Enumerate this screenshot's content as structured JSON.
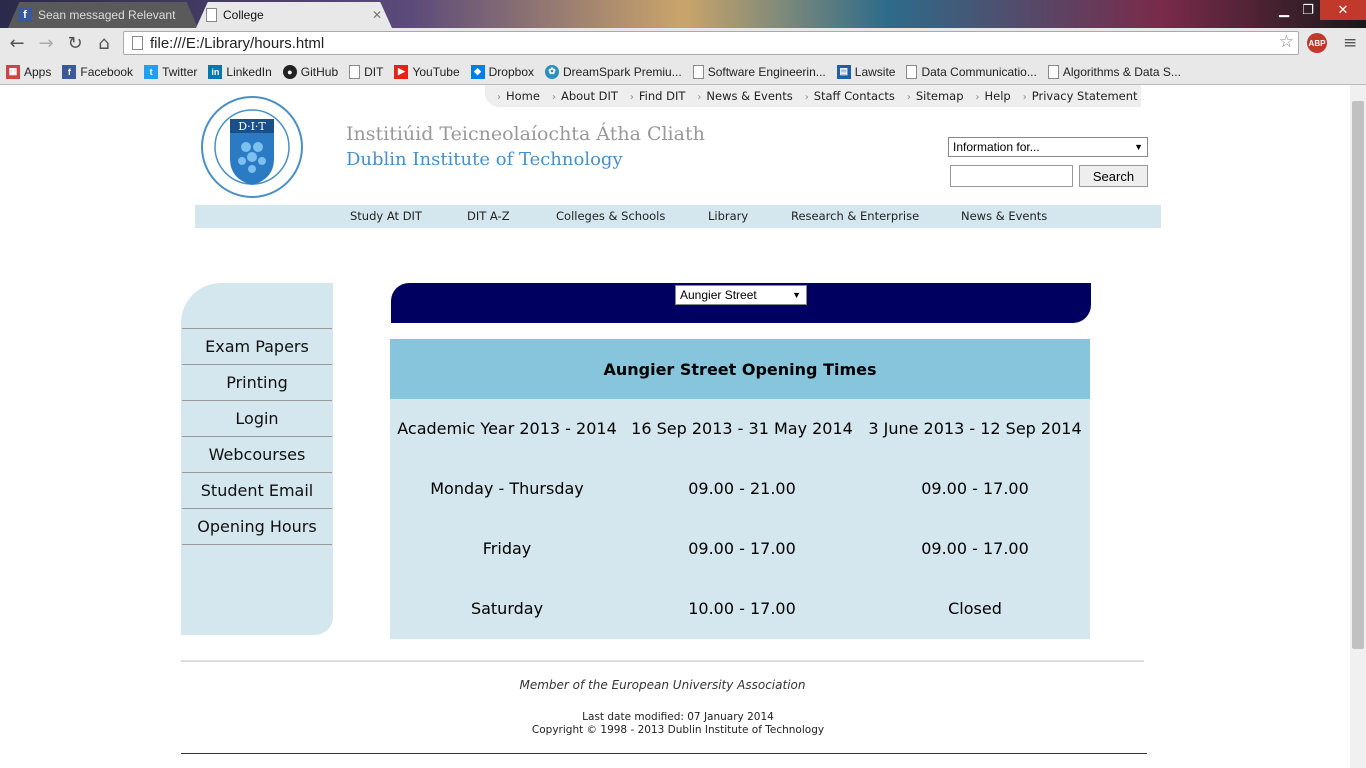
{
  "browser": {
    "tabs": [
      {
        "title": "Sean messaged Relevant c"
      },
      {
        "title": "College"
      }
    ],
    "address": "file:///E:/Library/hours.html",
    "extension_badge": "ABP",
    "bookmarks": [
      {
        "label": "Apps",
        "icon": "apps-icon"
      },
      {
        "label": "Facebook",
        "icon": "facebook-icon"
      },
      {
        "label": "Twitter",
        "icon": "twitter-icon"
      },
      {
        "label": "LinkedIn",
        "icon": "linkedin-icon"
      },
      {
        "label": "GitHub",
        "icon": "github-icon"
      },
      {
        "label": "DIT",
        "icon": "page-icon"
      },
      {
        "label": "YouTube",
        "icon": "youtube-icon"
      },
      {
        "label": "Dropbox",
        "icon": "dropbox-icon"
      },
      {
        "label": "DreamSpark Premiu...",
        "icon": "dreamspark-icon"
      },
      {
        "label": "Software Engineerin...",
        "icon": "page-icon"
      },
      {
        "label": "Lawsite",
        "icon": "lawsite-icon"
      },
      {
        "label": "Data Communicatio...",
        "icon": "page-icon"
      },
      {
        "label": "Algorithms & Data S...",
        "icon": "page-icon"
      }
    ]
  },
  "site": {
    "top_links": [
      "Home",
      "About DIT",
      "Find DIT",
      "News & Events",
      "Staff Contacts",
      "Sitemap",
      "Help",
      "Privacy Statement"
    ],
    "logo_text": "D·I·T",
    "name_irish": "Institiúid Teicneolaíochta Átha Cliath",
    "name_english": "Dublin Institute of Technology",
    "info_select": "Information for...",
    "search_button": "Search",
    "main_nav": [
      "Study At DIT",
      "DIT A-Z",
      "Colleges & Schools",
      "Library",
      "Research & Enterprise",
      "News & Events"
    ]
  },
  "sidebar": {
    "items": [
      "Exam Papers",
      "Printing",
      "Login",
      "Webcourses",
      "Student Email",
      "Opening Hours"
    ]
  },
  "campus_select": "Aungier Street",
  "hours": {
    "title": "Aungier Street Opening Times",
    "rows": [
      [
        "Academic Year 2013 - 2014",
        "16 Sep 2013 - 31 May 2014",
        "3 June 2013 - 12 Sep 2014"
      ],
      [
        "Monday - Thursday",
        "09.00 - 21.00",
        "09.00 - 17.00"
      ],
      [
        "Friday",
        "09.00 - 17.00",
        "09.00 - 17.00"
      ],
      [
        "Saturday",
        "10.00 - 17.00",
        "Closed"
      ]
    ]
  },
  "footer": {
    "member": "Member of the European University Association",
    "modified": "Last date modified: 07 January 2014",
    "copyright": "Copyright © 1998 - 2013 Dublin Institute of Technology"
  },
  "colors": {
    "light_blue": "#d4e7ef",
    "header_blue": "#86c5db",
    "navy": "#000060",
    "brand_blue": "#4a8fc7"
  }
}
